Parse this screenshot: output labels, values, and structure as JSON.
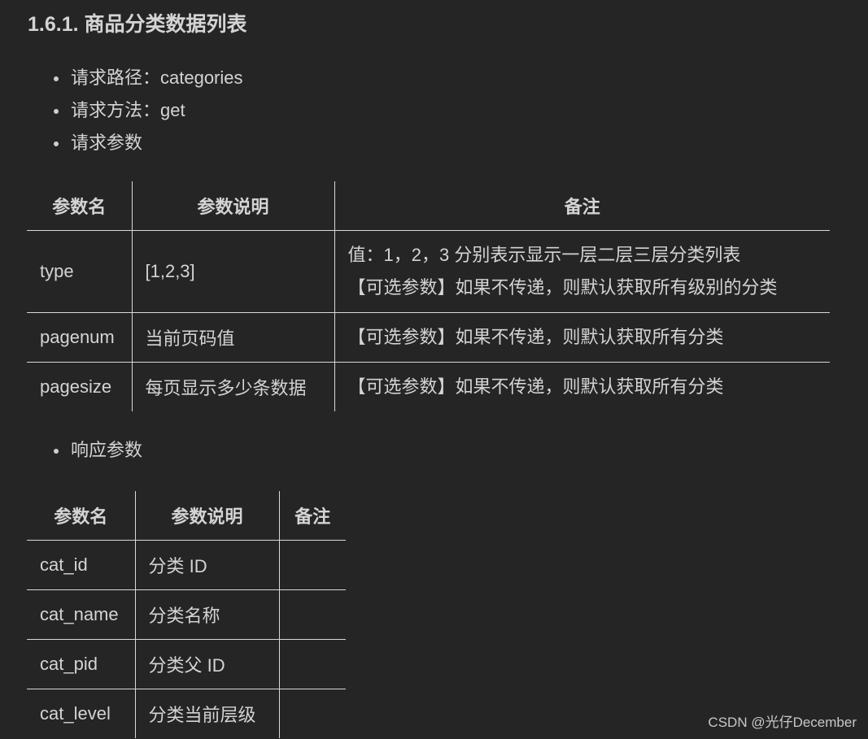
{
  "heading": "1.6.1. 商品分类数据列表",
  "request_items": [
    "请求路径：categories",
    "请求方法：get",
    "请求参数"
  ],
  "request_table": {
    "headers": [
      "参数名",
      "参数说明",
      "备注"
    ],
    "rows": [
      {
        "name": "type",
        "desc": "[1,2,3]",
        "note_lines": [
          "值：1，2，3 分别表示显示一层二层三层分类列表",
          "【可选参数】如果不传递，则默认获取所有级别的分类"
        ]
      },
      {
        "name": "pagenum",
        "desc": "当前页码值",
        "note_lines": [
          "【可选参数】如果不传递，则默认获取所有分类"
        ]
      },
      {
        "name": "pagesize",
        "desc": "每页显示多少条数据",
        "note_lines": [
          "【可选参数】如果不传递，则默认获取所有分类"
        ]
      }
    ]
  },
  "response_item": "响应参数",
  "response_table": {
    "headers": [
      "参数名",
      "参数说明",
      "备注"
    ],
    "rows": [
      {
        "name": "cat_id",
        "desc": "分类 ID",
        "note": ""
      },
      {
        "name": "cat_name",
        "desc": "分类名称",
        "note": ""
      },
      {
        "name": "cat_pid",
        "desc": "分类父 ID",
        "note": ""
      },
      {
        "name": "cat_level",
        "desc": "分类当前层级",
        "note": ""
      }
    ]
  },
  "watermark": "CSDN @光仔December"
}
